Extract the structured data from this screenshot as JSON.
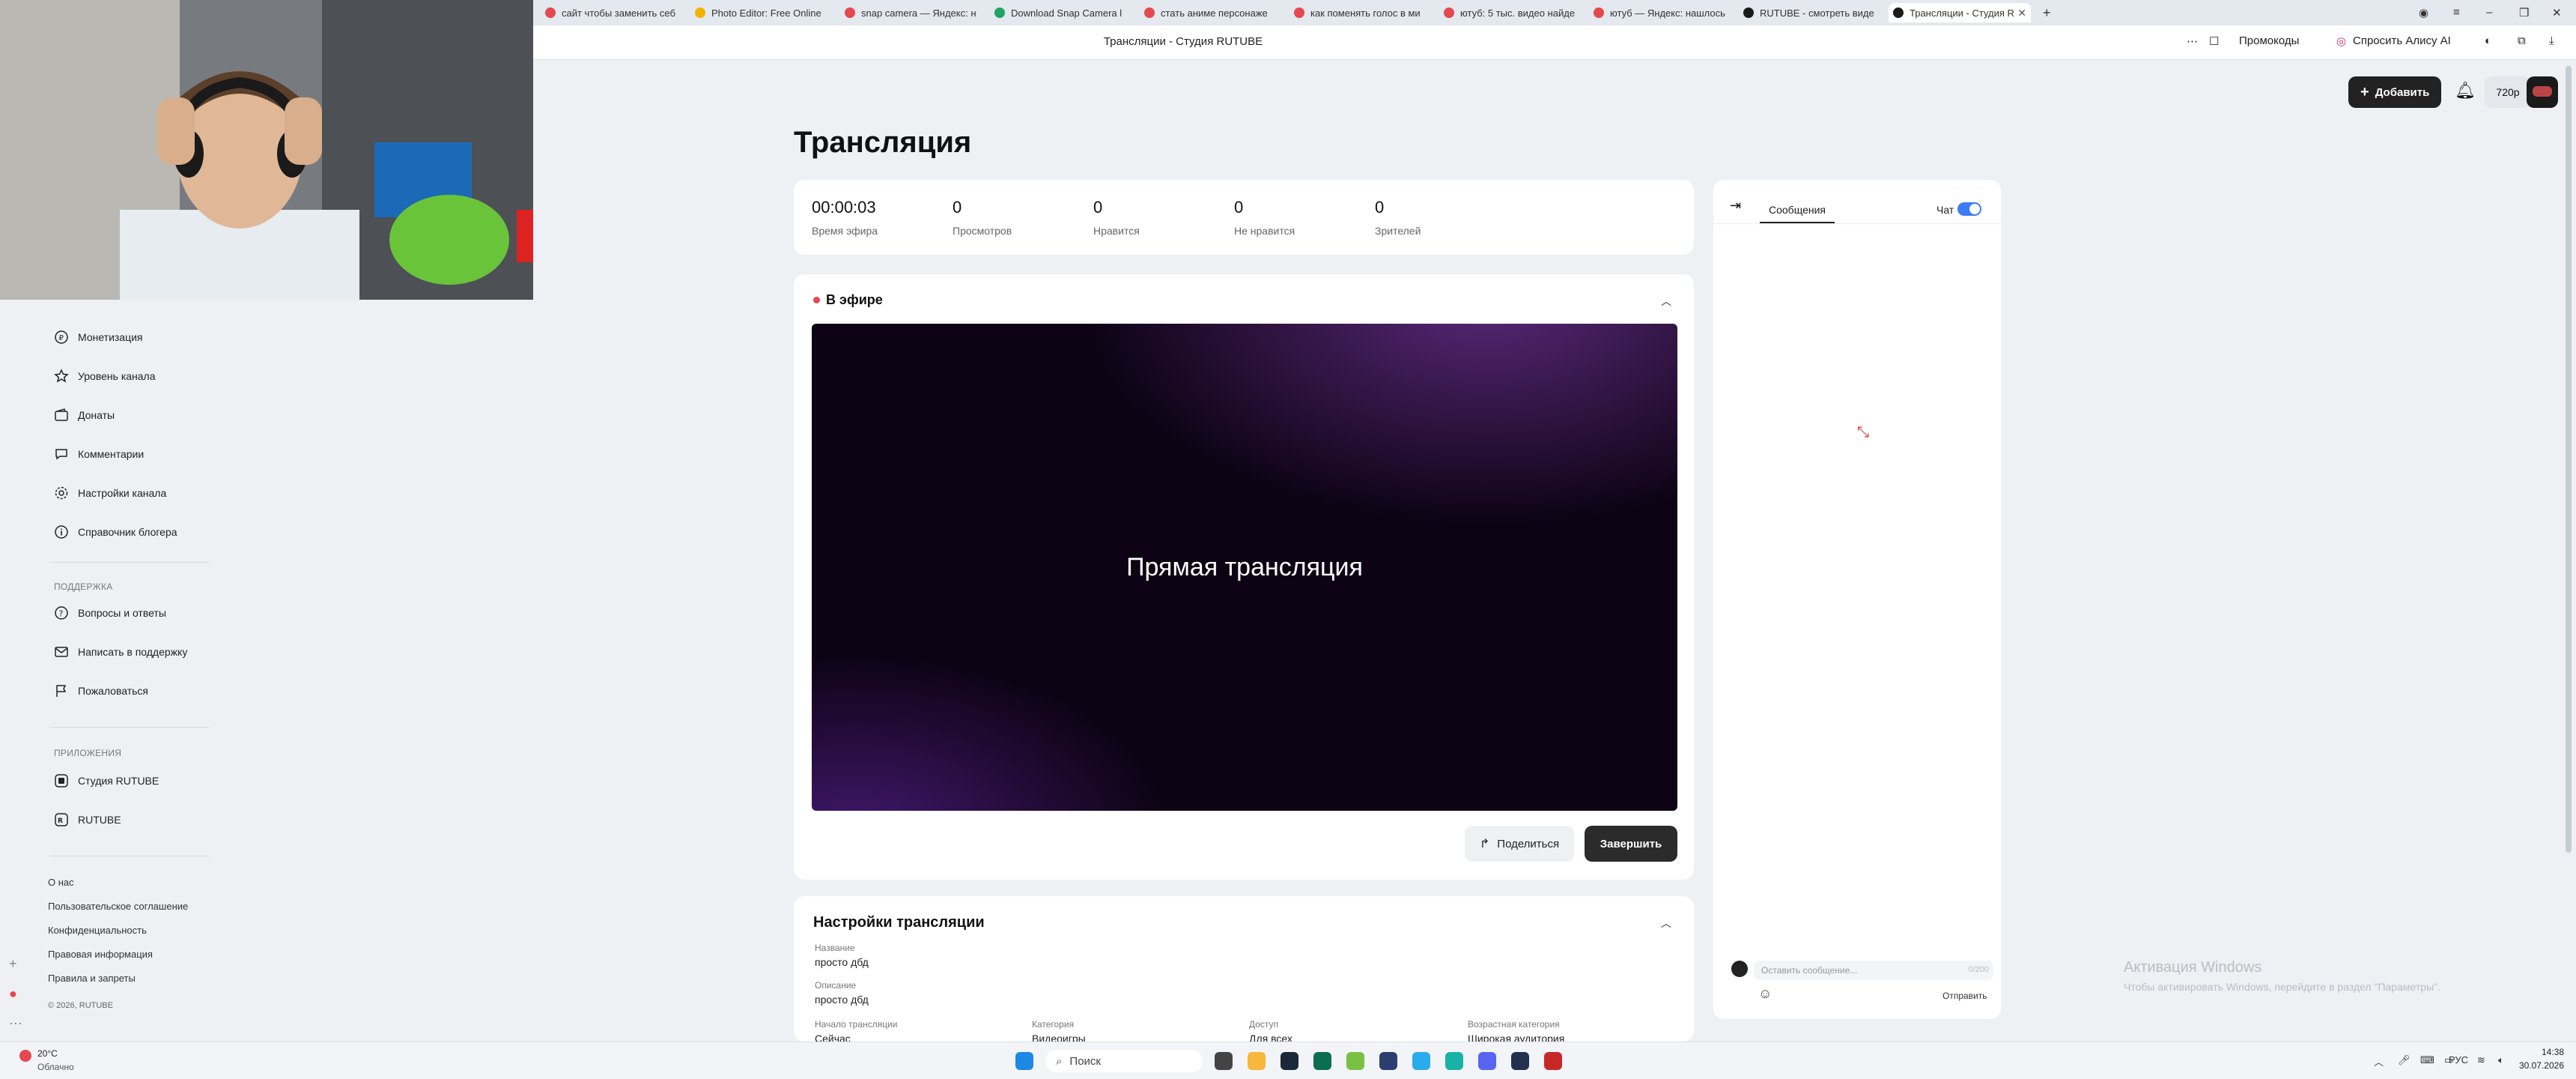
{
  "browser": {
    "tabs": [
      {
        "label": "сайт чтобы заменить себ",
        "color": "#e5484d"
      },
      {
        "label": "Photo Editor: Free Online",
        "color": "#f0b400"
      },
      {
        "label": "snap camera — Яндекс: н",
        "color": "#e5484d"
      },
      {
        "label": "Download Snap Camera l",
        "color": "#21a366"
      },
      {
        "label": "стать аниме персонаже",
        "color": "#e5484d"
      },
      {
        "label": "как поменять голос в ми",
        "color": "#e5484d"
      },
      {
        "label": "ютуб: 5 тыс. видео найде",
        "color": "#e5484d"
      },
      {
        "label": "ютуб — Яндекс: нашлось",
        "color": "#e5484d"
      },
      {
        "label": "RUTUBE - смотреть виде",
        "color": "#1a1a1a"
      },
      {
        "label": "Трансляции - Студия R",
        "color": "#1a1a1a"
      }
    ],
    "new_tab": "+",
    "page_title": "Трансляции - Студия RUTUBE",
    "promo": "Промокоды",
    "ask_alice": "Спросить Алису AI"
  },
  "sidebar": {
    "items": [
      {
        "label": "Монетизация",
        "icon": "ruble-icon"
      },
      {
        "label": "Уровень канала",
        "icon": "star-icon"
      },
      {
        "label": "Донаты",
        "icon": "wallet-icon"
      },
      {
        "label": "Комментарии",
        "icon": "comment-icon"
      },
      {
        "label": "Настройки канала",
        "icon": "gear-icon"
      },
      {
        "label": "Справочник блогера",
        "icon": "info-icon"
      }
    ],
    "support_heading": "ПОДДЕРЖКА",
    "support": [
      {
        "label": "Вопросы и ответы",
        "icon": "question-icon"
      },
      {
        "label": "Написать в поддержку",
        "icon": "mail-icon"
      },
      {
        "label": "Пожаловаться",
        "icon": "flag-icon"
      }
    ],
    "apps_heading": "ПРИЛОЖЕНИЯ",
    "apps": [
      {
        "label": "Студия RUTUBE",
        "icon": "rutube-studio-icon"
      },
      {
        "label": "RUTUBE",
        "icon": "rutube-icon"
      }
    ],
    "footer_links": [
      "О нас",
      "Пользовательское соглашение",
      "Конфиденциальность",
      "Правовая информация",
      "Правила и запреты"
    ],
    "copyright": "© 2026, RUTUBE"
  },
  "header": {
    "add_button": "Добавить",
    "quality": "720p"
  },
  "main": {
    "title": "Трансляция",
    "stats": [
      {
        "value": "00:00:03",
        "label": "Время эфира"
      },
      {
        "value": "0",
        "label": "Просмотров"
      },
      {
        "value": "0",
        "label": "Нравится"
      },
      {
        "value": "0",
        "label": "Не нравится"
      },
      {
        "value": "0",
        "label": "Зрителей"
      }
    ],
    "live_label": "В эфире",
    "preview_text": "Прямая трансляция",
    "share_button": "Поделиться",
    "end_button": "Завершить",
    "settings": {
      "title": "Настройки трансляции",
      "name_label": "Название",
      "name_value": "просто дбд",
      "desc_label": "Описание",
      "desc_value": "просто дбд",
      "start_label": "Начало трансляции",
      "start_value": "Сейчас",
      "category_label": "Категория",
      "category_value": "Видеоигры",
      "access_label": "Доступ",
      "access_value": "Для всех",
      "age_label": "Возрастная категория",
      "age_value": "Широкая аудитория"
    }
  },
  "chat": {
    "tab_label": "Сообщения",
    "toggle_label": "Чат",
    "toggle_on": true,
    "input_placeholder": "Оставить сообщение...",
    "counter": "0/200",
    "send": "Отправить"
  },
  "watermark": {
    "title": "Активация Windows",
    "subtitle": "Чтобы активировать Windows, перейдите в раздел \"Параметры\"."
  },
  "taskbar": {
    "weather_temp": "20°C",
    "weather_desc": "Облачно",
    "search_placeholder": "Поиск",
    "lang": "РУС",
    "time": "14:38",
    "date": "30.07.2026"
  }
}
